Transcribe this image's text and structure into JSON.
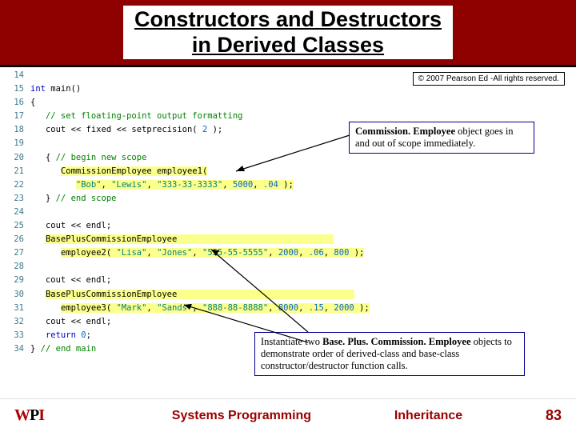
{
  "header": {
    "title": "Constructors and Destructors\nin Derived Classes"
  },
  "copyright": "© 2007 Pearson Ed -All rights reserved.",
  "callout1": {
    "bold": "Commission. Employee ",
    "rest": "object goes in and out of scope immediately."
  },
  "callout2": {
    "pre": "Instantiate two ",
    "bold": "Base. Plus. Commission. Employee",
    "rest": " objects to demonstrate order of derived-class and base-class constructor/destructor function calls."
  },
  "code": [
    {
      "n": "14",
      "h": []
    },
    {
      "n": "15",
      "h": [
        [
          "kw",
          "int"
        ],
        [
          "",
          " main()"
        ]
      ]
    },
    {
      "n": "16",
      "h": [
        [
          "",
          "{"
        ]
      ]
    },
    {
      "n": "17",
      "h": [
        [
          "",
          "   "
        ],
        [
          "cm",
          "// set floating-point output formatting"
        ]
      ]
    },
    {
      "n": "18",
      "h": [
        [
          "",
          "   cout << fixed << setprecision( "
        ],
        [
          "num",
          "2"
        ],
        [
          "",
          " );"
        ]
      ]
    },
    {
      "n": "19",
      "h": []
    },
    {
      "n": "20",
      "h": [
        [
          "",
          "   { "
        ],
        [
          "cm",
          "// begin new scope"
        ]
      ]
    },
    {
      "n": "21",
      "h": [
        [
          "",
          "      "
        ],
        [
          "hl",
          "CommissionEmployee employee1("
        ],
        [
          "",
          "                "
        ]
      ]
    },
    {
      "n": "22",
      "h": [
        [
          "",
          "         "
        ],
        [
          "hl",
          ""
        ],
        [
          "str",
          "\"Bob\""
        ],
        [
          "hl",
          ", "
        ],
        [
          "str",
          "\"Lewis\""
        ],
        [
          "hl",
          ", "
        ],
        [
          "str",
          "\"333-33-3333\""
        ],
        [
          "hl",
          ", "
        ],
        [
          "num",
          "5000"
        ],
        [
          "hl",
          ", "
        ],
        [
          "num",
          ".04"
        ],
        [
          "hl",
          " );"
        ]
      ]
    },
    {
      "n": "23",
      "h": [
        [
          "",
          "   } "
        ],
        [
          "cm",
          "// end scope"
        ]
      ]
    },
    {
      "n": "24",
      "h": []
    },
    {
      "n": "25",
      "h": [
        [
          "",
          "   cout << endl;"
        ]
      ]
    },
    {
      "n": "26",
      "h": [
        [
          "",
          "   "
        ],
        [
          "hl",
          "BasePlusCommissionEmployee                               "
        ]
      ]
    },
    {
      "n": "27",
      "h": [
        [
          "",
          "      "
        ],
        [
          "hl",
          "employee2( "
        ],
        [
          "str",
          "\"Lisa\""
        ],
        [
          "hl",
          ", "
        ],
        [
          "str",
          "\"Jones\""
        ],
        [
          "hl",
          ", "
        ],
        [
          "str",
          "\"555-55-5555\""
        ],
        [
          "hl",
          ", "
        ],
        [
          "num",
          "2000"
        ],
        [
          "hl",
          ", "
        ],
        [
          "num",
          ".06"
        ],
        [
          "hl",
          ", "
        ],
        [
          "num",
          "800"
        ],
        [
          "hl",
          " );"
        ]
      ]
    },
    {
      "n": "28",
      "h": []
    },
    {
      "n": "29",
      "h": [
        [
          "",
          "   cout << endl;"
        ]
      ]
    },
    {
      "n": "30",
      "h": [
        [
          "",
          "   "
        ],
        [
          "hl",
          "BasePlusCommissionEmployee                                   "
        ]
      ]
    },
    {
      "n": "31",
      "h": [
        [
          "",
          "      "
        ],
        [
          "hl",
          "employee3( "
        ],
        [
          "str",
          "\"Mark\""
        ],
        [
          "hl",
          ", "
        ],
        [
          "str",
          "\"Sands\""
        ],
        [
          "hl",
          ", "
        ],
        [
          "str",
          "\"888-88-8888\""
        ],
        [
          "hl",
          ", "
        ],
        [
          "num",
          "8000"
        ],
        [
          "hl",
          ", "
        ],
        [
          "num",
          ".15"
        ],
        [
          "hl",
          ", "
        ],
        [
          "num",
          "2000"
        ],
        [
          "hl",
          " );"
        ]
      ]
    },
    {
      "n": "32",
      "h": [
        [
          "",
          "   cout << endl;"
        ]
      ]
    },
    {
      "n": "33",
      "h": [
        [
          "",
          "   "
        ],
        [
          "kw",
          "return"
        ],
        [
          "",
          " "
        ],
        [
          "num",
          "0"
        ],
        [
          "",
          ";"
        ]
      ]
    },
    {
      "n": "34",
      "h": [
        [
          "",
          "} "
        ],
        [
          "cm",
          "// end main"
        ]
      ]
    }
  ],
  "footer": {
    "left": "Systems Programming",
    "center": "Inheritance",
    "page": "83",
    "logo": "WPI"
  }
}
